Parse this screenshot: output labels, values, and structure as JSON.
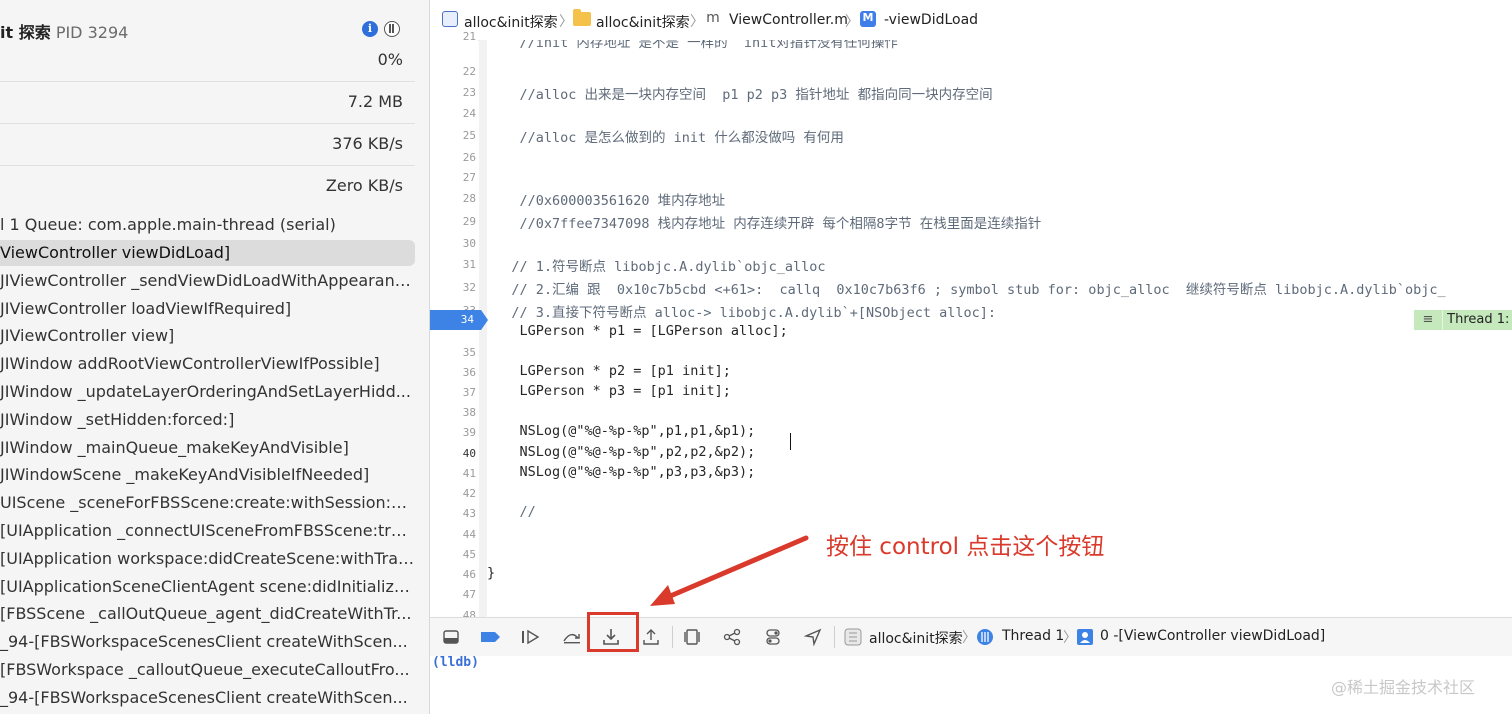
{
  "debug_navigator": {
    "process_name": "it 探索",
    "pid": "PID 3294",
    "cpu": "0%",
    "memory": "7.2 MB",
    "disk": "376 KB/s",
    "network": "Zero KB/s",
    "thread_header": "l 1 Queue: com.apple.main-thread (serial)",
    "frames": [
      "ViewController viewDidLoad]",
      "JIViewController _sendViewDidLoadWithAppearanc...",
      "JIViewController loadViewIfRequired]",
      "JIViewController view]",
      "JIWindow addRootViewControllerViewIfPossible]",
      "JIWindow _updateLayerOrderingAndSetLayerHidd...",
      "JIWindow _setHidden:forced:]",
      "JIWindow _mainQueue_makeKeyAndVisible]",
      "JIWindowScene _makeKeyAndVisibleIfNeeded]",
      "UIScene _sceneForFBSScene:create:withSession:c...",
      "[UIApplication _connectUISceneFromFBSScene:tra...",
      "[UIApplication workspace:didCreateScene:withTran...",
      "[UIApplicationSceneClientAgent scene:didInitialize...",
      "[FBSScene _callOutQueue_agent_didCreateWithTr...",
      "_94-[FBSWorkspaceScenesClient createWithScen...",
      "[FBSWorkspace _calloutQueue_executeCalloutFro...",
      "_94-[FBSWorkspaceScenesClient createWithScen..."
    ]
  },
  "jumpbar": {
    "project": "alloc&init探索",
    "folder": "alloc&init探索",
    "file_icon": "m",
    "file": "ViewController.m",
    "method_icon": "M",
    "method": "-viewDidLoad"
  },
  "code_lines": [
    {
      "n": "21",
      "text": "    //init 内存地址 是不是 一样的  init对指针没有任何操作"
    },
    {
      "n": "22",
      "text": ""
    },
    {
      "n": "23",
      "text": "    //alloc 出来是一块内存空间  p1 p2 p3 指针地址 都指向同一块内存空间"
    },
    {
      "n": "24",
      "text": ""
    },
    {
      "n": "25",
      "text": "    //alloc 是怎么做到的 init 什么都没做吗 有何用"
    },
    {
      "n": "26",
      "text": ""
    },
    {
      "n": "27",
      "text": ""
    },
    {
      "n": "28",
      "text": "    //0x600003561620 堆内存地址"
    },
    {
      "n": "29",
      "text": "    //0x7ffee7347098 栈内存地址 内存连续开辟 每个相隔8字节 在栈里面是连续指针"
    },
    {
      "n": "30",
      "text": ""
    },
    {
      "n": "31",
      "text": "   // 1.符号断点 libobjc.A.dylib`objc_alloc"
    },
    {
      "n": "32",
      "text": "   // 2.汇编 跟  0x10c7b5cbd <+61>:  callq  0x10c7b63f6 ; symbol stub for: objc_alloc  继续符号断点 libobjc.A.dylib`objc_"
    },
    {
      "n": "33",
      "text": "   // 3.直接下符号断点 alloc-> libobjc.A.dylib`+[NSObject alloc]:"
    },
    {
      "n": "34",
      "text": "    LGPerson * p1 = [LGPerson alloc];"
    },
    {
      "n": "35",
      "text": ""
    },
    {
      "n": "36",
      "text": "    LGPerson * p2 = [p1 init];"
    },
    {
      "n": "37",
      "text": "    LGPerson * p3 = [p1 init];"
    },
    {
      "n": "38",
      "text": ""
    },
    {
      "n": "39",
      "text": "    NSLog(@\"%@-%p-%p\",p1,p1,&p1);"
    },
    {
      "n": "40",
      "text": "    NSLog(@\"%@-%p-%p\",p2,p2,&p2);"
    },
    {
      "n": "41",
      "text": "    NSLog(@\"%@-%p-%p\",p3,p3,&p3);"
    },
    {
      "n": "42",
      "text": ""
    },
    {
      "n": "43",
      "text": "    //"
    },
    {
      "n": "44",
      "text": ""
    },
    {
      "n": "45",
      "text": ""
    },
    {
      "n": "46",
      "text": "}"
    },
    {
      "n": "47",
      "text": ""
    },
    {
      "n": "48",
      "text": ""
    }
  ],
  "current_line": "34",
  "thread_badge": "Thread 1:",
  "debugbar": {
    "project": "alloc&init探索",
    "thread": "Thread 1",
    "frame": "0 -[ViewController viewDidLoad]"
  },
  "console": {
    "prompt": "(lldb)"
  },
  "annotation": "按住 control 点击这个按钮",
  "watermark": "@稀土掘金技术社区",
  "colors": {
    "accent": "#3d82e5",
    "annotation_red": "#d93a2b",
    "pc_highlight": "#e7f6e3"
  },
  "icons": [
    "info-icon",
    "threads-icon",
    "folder-icon",
    "method-icon",
    "hide-console-icon",
    "breakpoints-toggle-icon",
    "continue-icon",
    "step-over-icon",
    "step-into-icon",
    "step-out-icon",
    "view-debugger-icon",
    "memory-graph-icon",
    "environment-overrides-icon",
    "location-icon"
  ]
}
